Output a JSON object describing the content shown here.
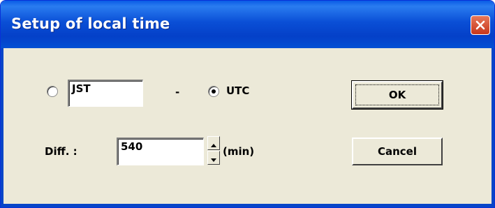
{
  "window": {
    "title": "Setup of local time",
    "close_icon": "close-icon"
  },
  "zone": {
    "local_value": "JST",
    "separator": "-",
    "utc_label": "UTC",
    "selected": "UTC"
  },
  "diff": {
    "label": "Diff. :",
    "value": "540",
    "unit": "(min)"
  },
  "buttons": {
    "ok": "OK",
    "cancel": "Cancel"
  },
  "colors": {
    "titlebar": "#0a4fd6",
    "dialog_face": "#ece9d8",
    "close_button": "#d94a2a"
  }
}
